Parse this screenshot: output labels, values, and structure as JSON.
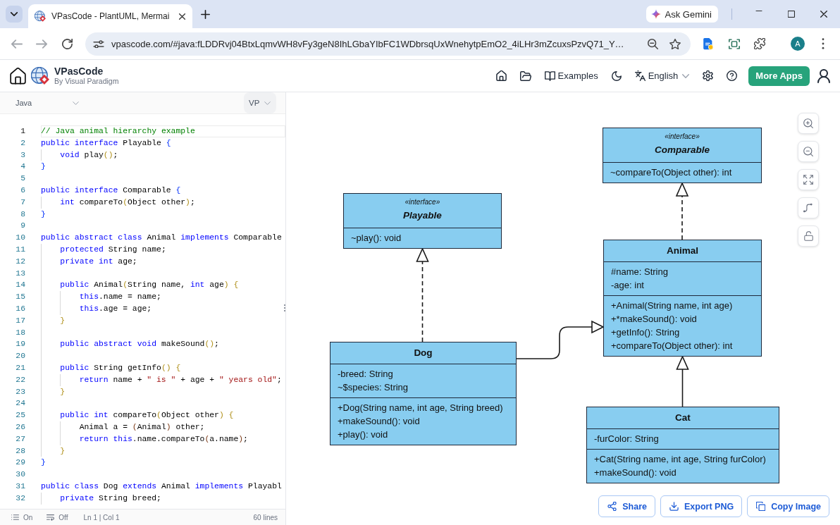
{
  "browser": {
    "tab_title": "VPasCode - PlantUML, Mermai",
    "gemini_button": "Ask Gemini",
    "address": "vpascode.com/#java:fLDDRvj04BtxLqmvWH8vFy3geN8IhLGbaYIbFC1WDbrsqUxWnehytpEmO2_4iLHr3mZcuxsPzvQ71_Y…",
    "profile_initial": "A"
  },
  "header": {
    "brand": "VPasCode",
    "tagline": "By Visual Paradigm",
    "examples": "Examples",
    "language": "English",
    "more_apps": "More Apps"
  },
  "editor": {
    "language": "Java",
    "theme": "VP",
    "lines": [
      {
        "number": "1",
        "current": true,
        "tokens": [
          {
            "kind": "comment",
            "text": "// Java animal hierarchy example"
          }
        ]
      },
      {
        "number": "2",
        "current": false,
        "tokens": [
          {
            "kind": "keyword",
            "text": "public interface"
          },
          {
            "kind": "plain",
            "text": " Playable "
          },
          {
            "kind": "bracket1",
            "text": "{"
          }
        ]
      },
      {
        "number": "3",
        "current": false,
        "tokens": [
          {
            "kind": "keyword",
            "text": "    void"
          },
          {
            "kind": "plain",
            "text": " play"
          },
          {
            "kind": "bracket2",
            "text": "()"
          },
          {
            "kind": "plain",
            "text": ";"
          }
        ]
      },
      {
        "number": "4",
        "current": false,
        "tokens": [
          {
            "kind": "bracket1",
            "text": "}"
          }
        ]
      },
      {
        "number": "5",
        "current": false
      },
      {
        "number": "6",
        "current": false,
        "tokens": [
          {
            "kind": "keyword",
            "text": "public interface"
          },
          {
            "kind": "plain",
            "text": " Comparable "
          },
          {
            "kind": "bracket1",
            "text": "{"
          }
        ]
      },
      {
        "number": "7",
        "current": false,
        "tokens": [
          {
            "kind": "keyword",
            "text": "    int"
          },
          {
            "kind": "plain",
            "text": " compareTo"
          },
          {
            "kind": "bracket2",
            "text": "("
          },
          {
            "kind": "plain",
            "text": "Object other"
          },
          {
            "kind": "bracket2",
            "text": ")"
          },
          {
            "kind": "plain",
            "text": ";"
          }
        ]
      },
      {
        "number": "8",
        "current": false,
        "tokens": [
          {
            "kind": "bracket1",
            "text": "}"
          }
        ]
      },
      {
        "number": "9",
        "current": false
      },
      {
        "number": "10",
        "current": false,
        "tokens": [
          {
            "kind": "keyword",
            "text": "public abstract class"
          },
          {
            "kind": "plain",
            "text": " Animal "
          },
          {
            "kind": "keyword",
            "text": "implements"
          },
          {
            "kind": "plain",
            "text": " Comparable"
          }
        ]
      },
      {
        "number": "11",
        "current": false,
        "tokens": [
          {
            "kind": "keyword",
            "text": "    protected"
          },
          {
            "kind": "plain",
            "text": " String name;"
          }
        ]
      },
      {
        "number": "12",
        "current": false,
        "tokens": [
          {
            "kind": "keyword",
            "text": "    private int"
          },
          {
            "kind": "plain",
            "text": " age;"
          }
        ]
      },
      {
        "number": "13",
        "current": false
      },
      {
        "number": "14",
        "current": false,
        "tokens": [
          {
            "kind": "keyword",
            "text": "    public"
          },
          {
            "kind": "plain",
            "text": " Animal"
          },
          {
            "kind": "bracket2",
            "text": "("
          },
          {
            "kind": "plain",
            "text": "String name, "
          },
          {
            "kind": "keyword",
            "text": "int"
          },
          {
            "kind": "plain",
            "text": " age"
          },
          {
            "kind": "bracket2",
            "text": ") {"
          }
        ]
      },
      {
        "number": "15",
        "current": false,
        "tokens": [
          {
            "kind": "keyword",
            "text": "        this"
          },
          {
            "kind": "plain",
            "text": ".name = name;"
          }
        ]
      },
      {
        "number": "16",
        "current": false,
        "tokens": [
          {
            "kind": "keyword",
            "text": "        this"
          },
          {
            "kind": "plain",
            "text": ".age = age;"
          }
        ]
      },
      {
        "number": "17",
        "current": false,
        "tokens": [
          {
            "kind": "bracket2",
            "text": "    }"
          }
        ]
      },
      {
        "number": "18",
        "current": false
      },
      {
        "number": "19",
        "current": false,
        "tokens": [
          {
            "kind": "keyword",
            "text": "    public abstract void"
          },
          {
            "kind": "plain",
            "text": " makeSound"
          },
          {
            "kind": "bracket2",
            "text": "()"
          },
          {
            "kind": "plain",
            "text": ";"
          }
        ]
      },
      {
        "number": "20",
        "current": false
      },
      {
        "number": "21",
        "current": false,
        "tokens": [
          {
            "kind": "keyword",
            "text": "    public"
          },
          {
            "kind": "plain",
            "text": " String getInfo"
          },
          {
            "kind": "bracket2",
            "text": "() {"
          }
        ]
      },
      {
        "number": "22",
        "current": false,
        "tokens": [
          {
            "kind": "keyword",
            "text": "        return"
          },
          {
            "kind": "plain",
            "text": " name + "
          },
          {
            "kind": "string",
            "text": "\" is \""
          },
          {
            "kind": "plain",
            "text": " + age + "
          },
          {
            "kind": "string",
            "text": "\" years old\""
          },
          {
            "kind": "plain",
            "text": ";"
          }
        ]
      },
      {
        "number": "23",
        "current": false,
        "tokens": [
          {
            "kind": "bracket2",
            "text": "    }"
          }
        ]
      },
      {
        "number": "24",
        "current": false
      },
      {
        "number": "25",
        "current": false,
        "tokens": [
          {
            "kind": "keyword",
            "text": "    public int"
          },
          {
            "kind": "plain",
            "text": " compareTo"
          },
          {
            "kind": "bracket2",
            "text": "("
          },
          {
            "kind": "plain",
            "text": "Object other"
          },
          {
            "kind": "bracket2",
            "text": ") {"
          }
        ]
      },
      {
        "number": "26",
        "current": false,
        "tokens": [
          {
            "kind": "plain",
            "text": "        Animal a = "
          },
          {
            "kind": "bracket3",
            "text": "("
          },
          {
            "kind": "plain",
            "text": "Animal"
          },
          {
            "kind": "bracket3",
            "text": ")"
          },
          {
            "kind": "plain",
            "text": " other;"
          }
        ]
      },
      {
        "number": "27",
        "current": false,
        "tokens": [
          {
            "kind": "keyword",
            "text": "        return this"
          },
          {
            "kind": "plain",
            "text": ".name.compareTo"
          },
          {
            "kind": "bracket3",
            "text": "("
          },
          {
            "kind": "plain",
            "text": "a.name"
          },
          {
            "kind": "bracket3",
            "text": ")"
          },
          {
            "kind": "plain",
            "text": ";"
          }
        ]
      },
      {
        "number": "28",
        "current": false,
        "tokens": [
          {
            "kind": "bracket2",
            "text": "    }"
          }
        ]
      },
      {
        "number": "29",
        "current": false,
        "tokens": [
          {
            "kind": "bracket1",
            "text": "}"
          }
        ]
      },
      {
        "number": "30",
        "current": false
      },
      {
        "number": "31",
        "current": false,
        "tokens": [
          {
            "kind": "keyword",
            "text": "public class"
          },
          {
            "kind": "plain",
            "text": " Dog "
          },
          {
            "kind": "keyword",
            "text": "extends"
          },
          {
            "kind": "plain",
            "text": " Animal "
          },
          {
            "kind": "keyword",
            "text": "implements"
          },
          {
            "kind": "plain",
            "text": " Playabl"
          }
        ]
      },
      {
        "number": "32",
        "current": false,
        "tokens": [
          {
            "kind": "keyword",
            "text": "    private"
          },
          {
            "kind": "plain",
            "text": " String breed;"
          }
        ]
      }
    ],
    "status_bar": {
      "line_numbers": "On",
      "word_wrap": "Off",
      "cursor": "Ln 1 | Col 1",
      "line_count": "60 lines"
    }
  },
  "diagram": {
    "locked": false,
    "classes": [
      {
        "kind": "interface",
        "stereotype": "«interface»",
        "name": "Comparable",
        "methods": [
          "~compareTo(Object other): int"
        ]
      },
      {
        "kind": "interface",
        "stereotype": "«interface»",
        "name": "Playable",
        "methods": [
          "~play(): void"
        ]
      },
      {
        "kind": "class",
        "name": "Animal",
        "attributes": [
          "#name: String",
          "-age: int"
        ],
        "methods": [
          "+Animal(String name, int age)",
          "+*makeSound(): void",
          "+getInfo(): String",
          "+compareTo(Object other): int"
        ]
      },
      {
        "kind": "class",
        "name": "Dog",
        "attributes": [
          "-breed: String",
          "~$species: String"
        ],
        "methods": [
          "+Dog(String name, int age, String breed)",
          "+makeSound(): void",
          "+play(): void"
        ]
      },
      {
        "kind": "class",
        "name": "Cat",
        "attributes": [
          "-furColor: String"
        ],
        "methods": [
          "+Cat(String name, int age, String furColor)",
          "+makeSound(): void"
        ]
      }
    ],
    "relations": [
      {
        "kind": "realization"
      },
      {
        "kind": "realization"
      },
      {
        "kind": "generalization"
      },
      {
        "kind": "generalization"
      }
    ],
    "actions": [
      {
        "kind": "share",
        "label": "Share"
      },
      {
        "kind": "export",
        "label": "Export PNG"
      },
      {
        "kind": "copy",
        "label": "Copy Image"
      }
    ]
  }
}
